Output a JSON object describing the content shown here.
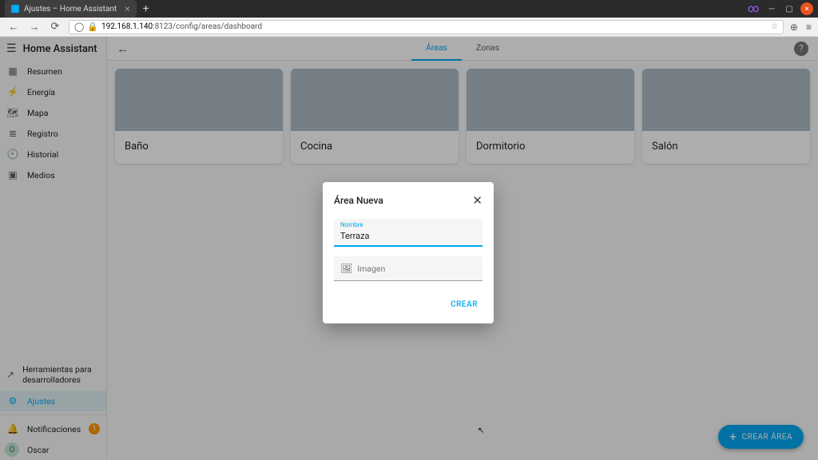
{
  "browser": {
    "tab_title": "Ajustes – Home Assistant",
    "url_host": "192.168.1.140",
    "url_rest": ":8123/config/areas/dashboard"
  },
  "sidebar": {
    "title": "Home Assistant",
    "items": [
      {
        "icon": "▦",
        "label": "Resumen"
      },
      {
        "icon": "⚡",
        "label": "Energía"
      },
      {
        "icon": "🗺",
        "label": "Mapa"
      },
      {
        "icon": "≣",
        "label": "Registro"
      },
      {
        "icon": "🕘",
        "label": "Historial"
      },
      {
        "icon": "▣",
        "label": "Medios"
      }
    ],
    "dev_tools": "Herramientas para desarrolladores",
    "settings": "Ajustes",
    "notifications": "Notificaciones",
    "notif_count": "1",
    "user_initial": "O",
    "user_name": "Oscar"
  },
  "topbar": {
    "tab_areas": "Áreas",
    "tab_zones": "Zonas"
  },
  "areas": [
    {
      "name": "Baño"
    },
    {
      "name": "Cocina"
    },
    {
      "name": "Dormitorio"
    },
    {
      "name": "Salón"
    }
  ],
  "fab": {
    "label": "CREAR ÁREA"
  },
  "dialog": {
    "title": "Área Nueva",
    "name_label": "Nombre",
    "name_value": "Terraza",
    "image_label": "Imagen",
    "create": "CREAR"
  }
}
